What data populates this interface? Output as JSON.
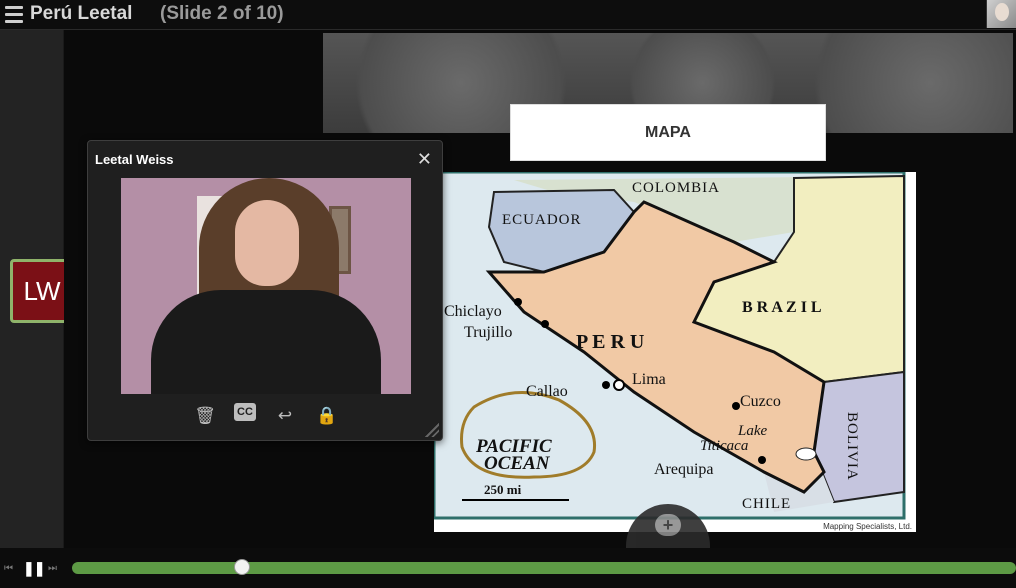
{
  "app": {
    "title": "Perú Leetal",
    "slide_counter": "(Slide 2 of 10)"
  },
  "presenter": {
    "initials": "LW",
    "name": "Leetal Weiss",
    "close_glyph": "✕"
  },
  "slide": {
    "title": "MAPA",
    "map_labels": {
      "colombia": "COLOMBIA",
      "ecuador": "ECUADOR",
      "brazil": "B R A Z I L",
      "peru": "P E R U",
      "chiclayo": "Chiclayo",
      "trujillo": "Trujillo",
      "callao": "Callao",
      "lima": "Lima",
      "cuzco": "Cuzco",
      "lake": "Lake",
      "titicaca": "Titicaca",
      "arequipa": "Arequipa",
      "chile": "CHILE",
      "bolivia": "BOLIVIA",
      "pacific": "PACIFIC",
      "ocean": "OCEAN",
      "scale": "250 mi"
    },
    "credit": "Mapping Specialists, Ltd."
  },
  "video_controls": {
    "trash_icon": "🗑",
    "cc_label": "CC",
    "reply_icon": "↩",
    "lock_icon": "🔒"
  },
  "playback": {
    "prev_icon": "⏮",
    "pause_icon": "❚❚",
    "next_icon": "⏭",
    "progress": 0.18
  },
  "colors": {
    "accent_green": "#5d9a45",
    "badge_red": "#7b1016"
  }
}
